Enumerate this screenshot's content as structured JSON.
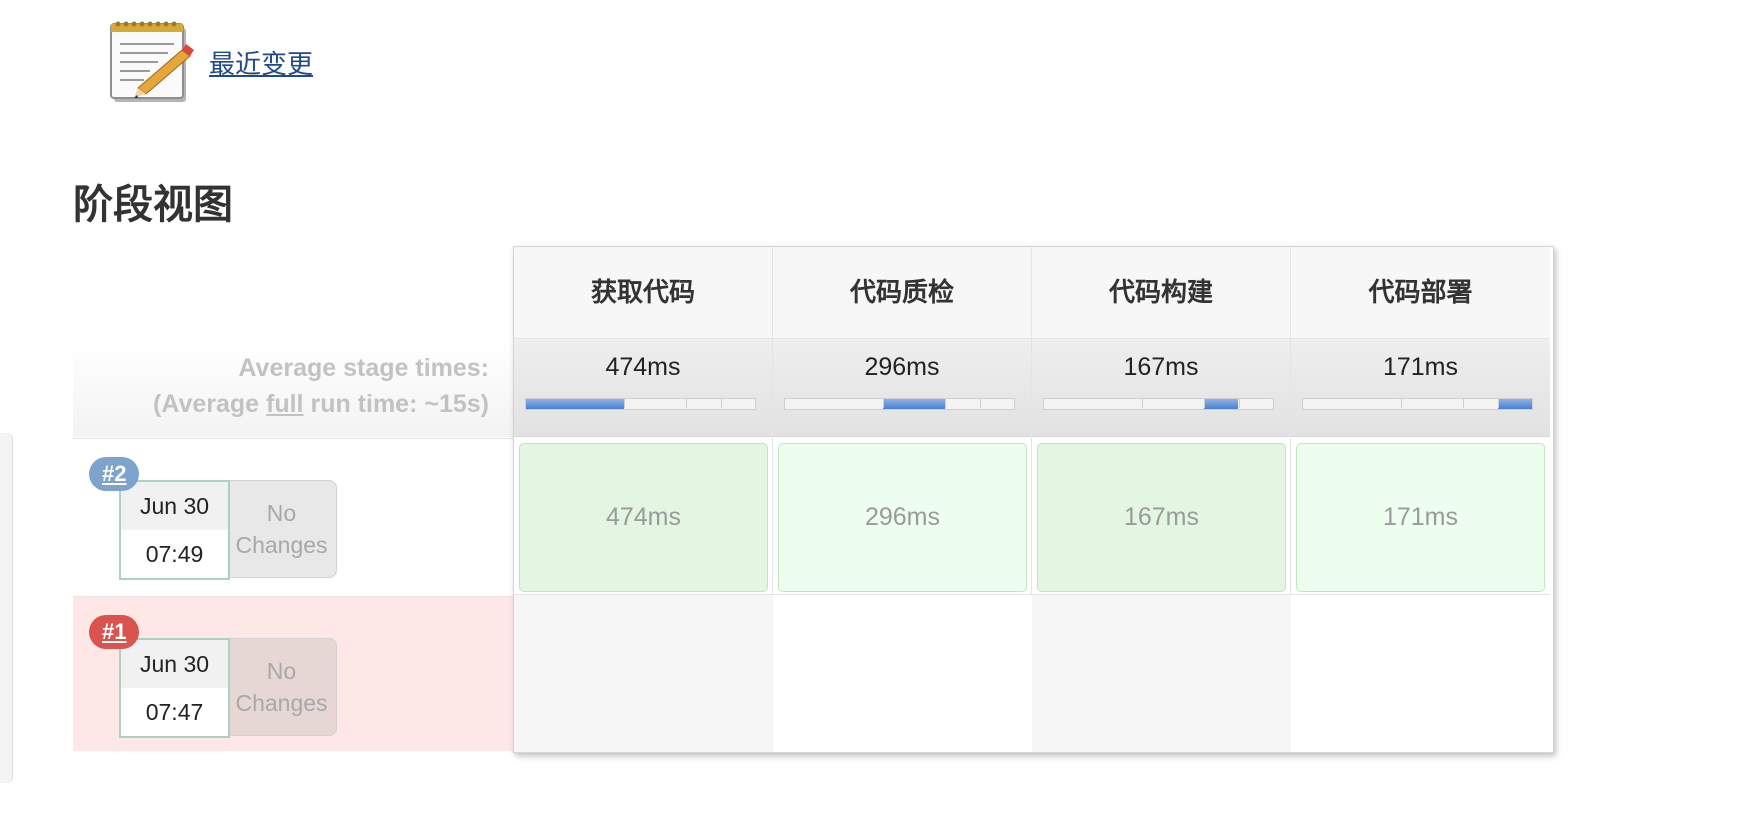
{
  "recent_changes": {
    "label": "最近变更",
    "icon": "notepad-pencil-icon"
  },
  "section_title": "阶段视图",
  "averages": {
    "line1": "Average stage times:",
    "line2_prefix": "(Average ",
    "line2_underlined": "full",
    "line2_suffix": " run time: ~15s)"
  },
  "stages": [
    {
      "name": "获取代码",
      "avg": "474ms",
      "bar_start": 0.0,
      "bar_fraction": 0.43
    },
    {
      "name": "代码质检",
      "avg": "296ms",
      "bar_start": 0.43,
      "bar_fraction": 0.27
    },
    {
      "name": "代码构建",
      "avg": "167ms",
      "bar_start": 0.7,
      "bar_fraction": 0.15
    },
    {
      "name": "代码部署",
      "avg": "171ms",
      "bar_start": 0.85,
      "bar_fraction": 0.15
    }
  ],
  "builds": [
    {
      "number": "#2",
      "status": "success",
      "date": "Jun 30",
      "time": "07:49",
      "changes": "No Changes",
      "stage_times": [
        "474ms",
        "296ms",
        "167ms",
        "171ms"
      ]
    },
    {
      "number": "#1",
      "status": "failed",
      "date": "Jun 30",
      "time": "07:47",
      "changes": "No Changes",
      "stage_times": []
    }
  ],
  "colors": {
    "link": "#204a87",
    "badge_success": "#7ea3cc",
    "badge_failed": "#d9534f",
    "stage_success": "#e2f6e2",
    "failed_row": "#fde8e6",
    "bar_fill": "#4a7fd0"
  }
}
